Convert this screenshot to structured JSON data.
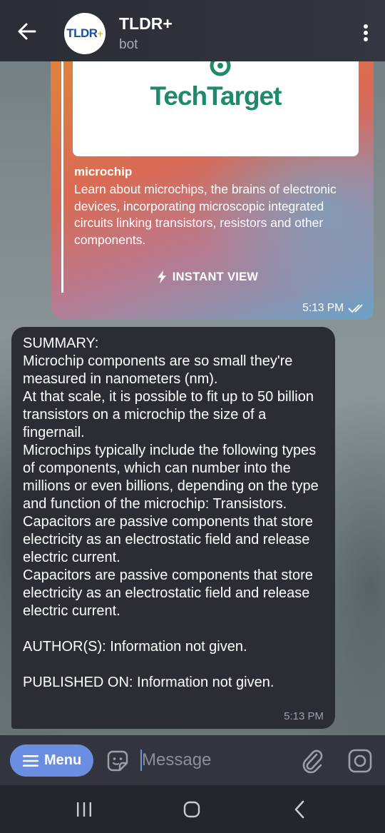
{
  "header": {
    "title": "TLDR+",
    "subtitle": "bot",
    "avatar_text": "TLDR",
    "avatar_plus": "+"
  },
  "link_preview": {
    "image_brand": "TechTarget",
    "site_name": "microchip",
    "description": "Learn about microchips, the brains of electronic devices, incorporating microscopic integrated circuits linking transistors, resistors and other components.",
    "instant_view_label": "INSTANT VIEW",
    "time": "5:13 PM",
    "status": "read"
  },
  "incoming_message": {
    "text": "SUMMARY:\nMicrochip components are so small they're measured in nanometers (nm).\nAt that scale, it is possible to fit up to 50 billion transistors on a microchip the size of a fingernail.\nMicrochips typically include the following types of components, which can number into the millions or even billions, depending on the type and function of the microchip: Transistors.\nCapacitors are passive components that store electricity as an electrostatic field and release electric current.\nCapacitors are passive components that store electricity as an electrostatic field and release electric current.\n\nAUTHOR(S): Information not given.\n\nPUBLISHED ON: Information not given.",
    "time": "5:13 PM"
  },
  "composer": {
    "menu_label": "Menu",
    "placeholder": "Message"
  },
  "colors": {
    "accent": "#6c8ee0",
    "header_bg": "#2a2c36",
    "incoming_bubble": "#2b2d35",
    "brand_green": "#1d8a6c"
  },
  "icons": [
    "back-arrow-icon",
    "more-vert-icon",
    "lightning-icon",
    "double-check-icon",
    "hamburger-icon",
    "sticker-icon",
    "attach-icon",
    "camera-icon",
    "nav-recent-icon",
    "nav-home-icon",
    "nav-back-icon"
  ]
}
